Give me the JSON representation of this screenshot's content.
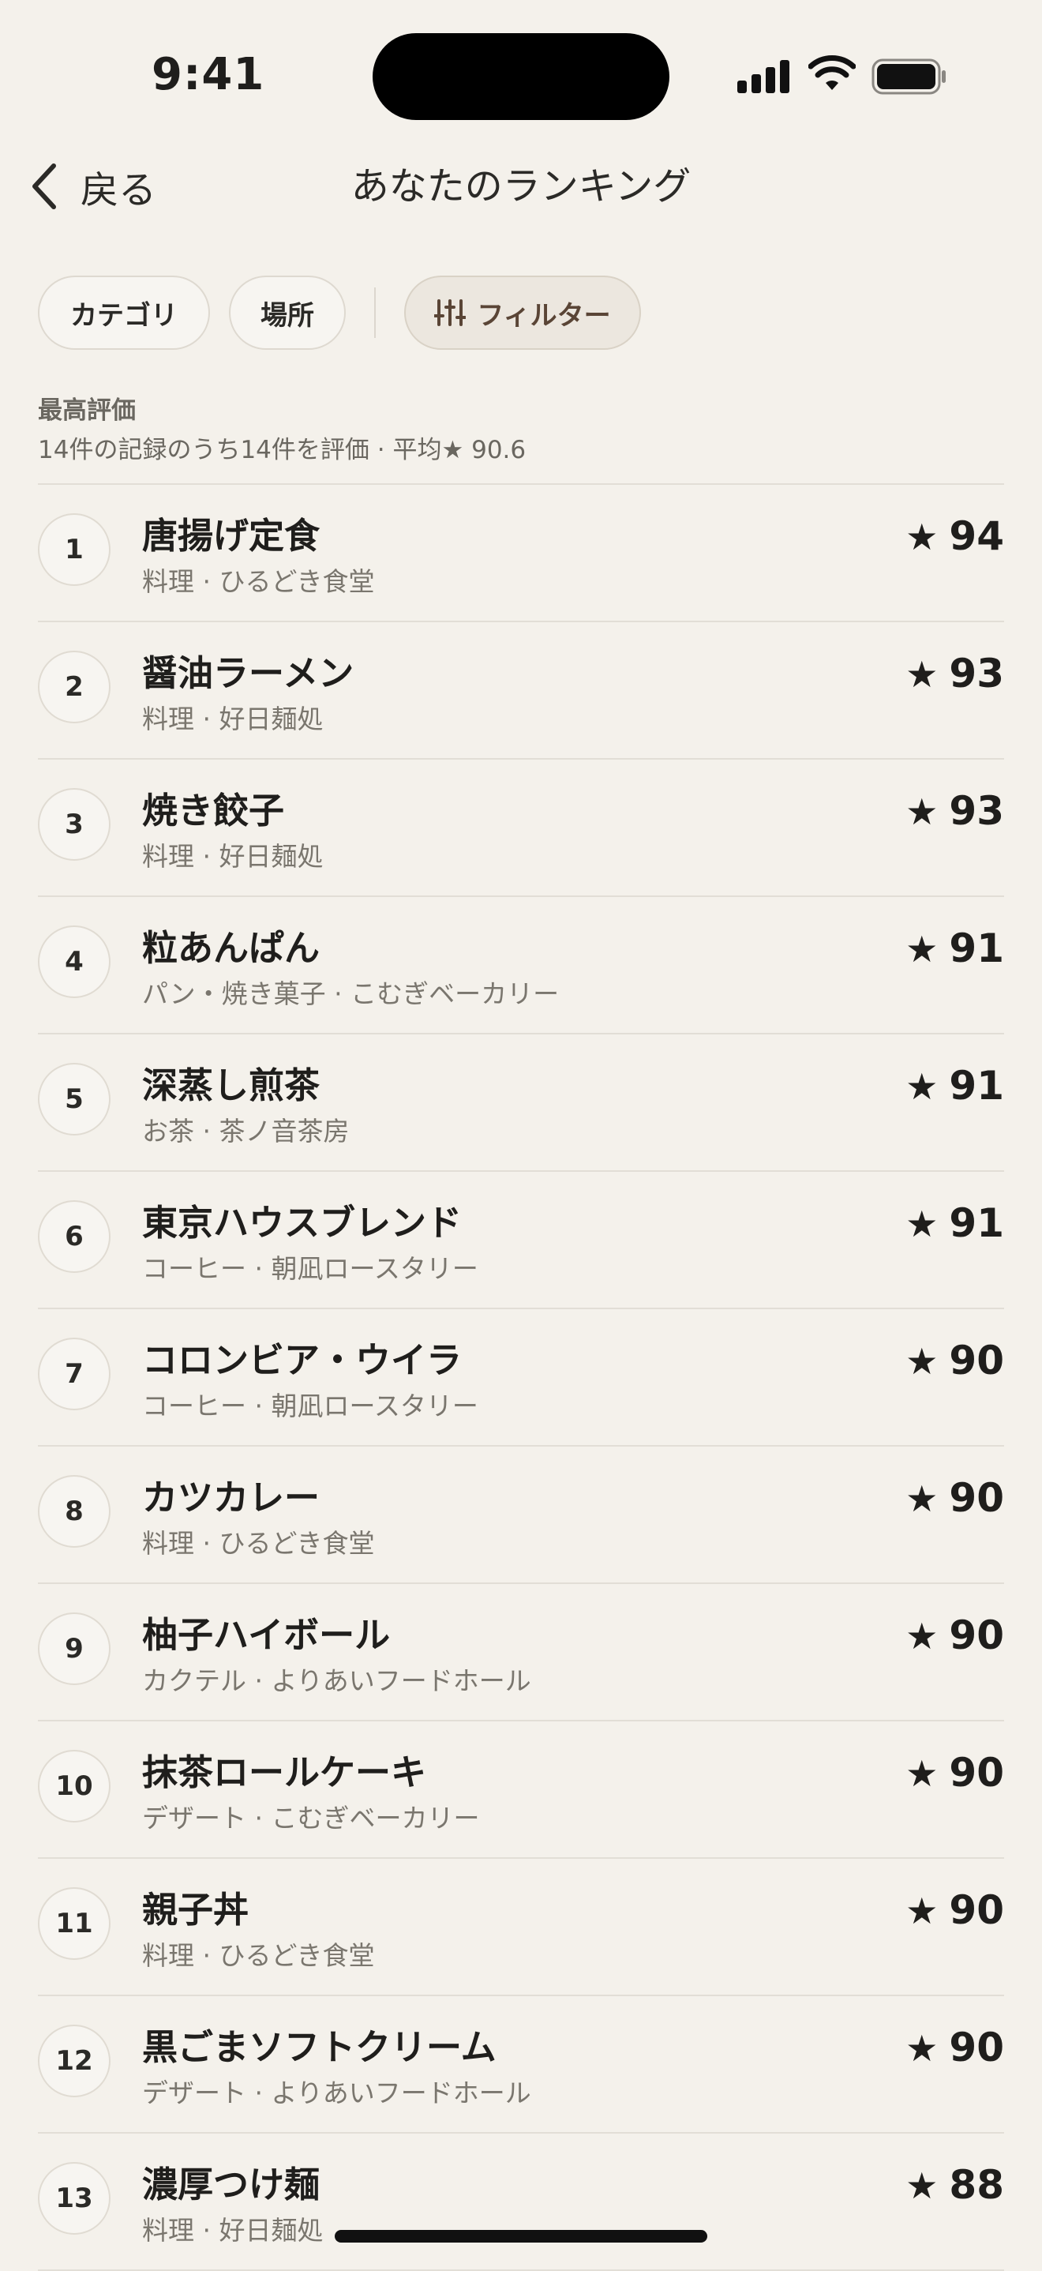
{
  "status_bar": {
    "time": "9:41"
  },
  "nav": {
    "back_label": "戻る",
    "title": "あなたのランキング"
  },
  "chips": {
    "category": "カテゴリ",
    "place": "場所",
    "filter": "フィルター"
  },
  "section": {
    "title": "最高評価",
    "summary": "14件の記録のうち14件を評価 · 平均★ 90.6"
  },
  "icons": {
    "back": "chevron-left-icon",
    "filter": "sliders-icon",
    "star": "star-icon"
  },
  "star_glyph": "★",
  "items": [
    {
      "rank": "1",
      "name": "唐揚げ定食",
      "sub": "料理 · ひるどき食堂",
      "score": "94"
    },
    {
      "rank": "2",
      "name": "醤油ラーメン",
      "sub": "料理 · 好日麺処",
      "score": "93"
    },
    {
      "rank": "3",
      "name": "焼き餃子",
      "sub": "料理 · 好日麺処",
      "score": "93"
    },
    {
      "rank": "4",
      "name": "粒あんぱん",
      "sub": "パン・焼き菓子 · こむぎベーカリー",
      "score": "91"
    },
    {
      "rank": "5",
      "name": "深蒸し煎茶",
      "sub": "お茶 · 茶ノ音茶房",
      "score": "91"
    },
    {
      "rank": "6",
      "name": "東京ハウスブレンド",
      "sub": "コーヒー · 朝凪ロースタリー",
      "score": "91"
    },
    {
      "rank": "7",
      "name": "コロンビア・ウイラ",
      "sub": "コーヒー · 朝凪ロースタリー",
      "score": "90"
    },
    {
      "rank": "8",
      "name": "カツカレー",
      "sub": "料理 · ひるどき食堂",
      "score": "90"
    },
    {
      "rank": "9",
      "name": "柚子ハイボール",
      "sub": "カクテル · よりあいフードホール",
      "score": "90"
    },
    {
      "rank": "10",
      "name": "抹茶ロールケーキ",
      "sub": "デザート · こむぎベーカリー",
      "score": "90"
    },
    {
      "rank": "11",
      "name": "親子丼",
      "sub": "料理 · ひるどき食堂",
      "score": "90"
    },
    {
      "rank": "12",
      "name": "黒ごまソフトクリーム",
      "sub": "デザート · よりあいフードホール",
      "score": "90"
    },
    {
      "rank": "13",
      "name": "濃厚つけ麺",
      "sub": "料理 · 好日麺処",
      "score": "88"
    }
  ]
}
